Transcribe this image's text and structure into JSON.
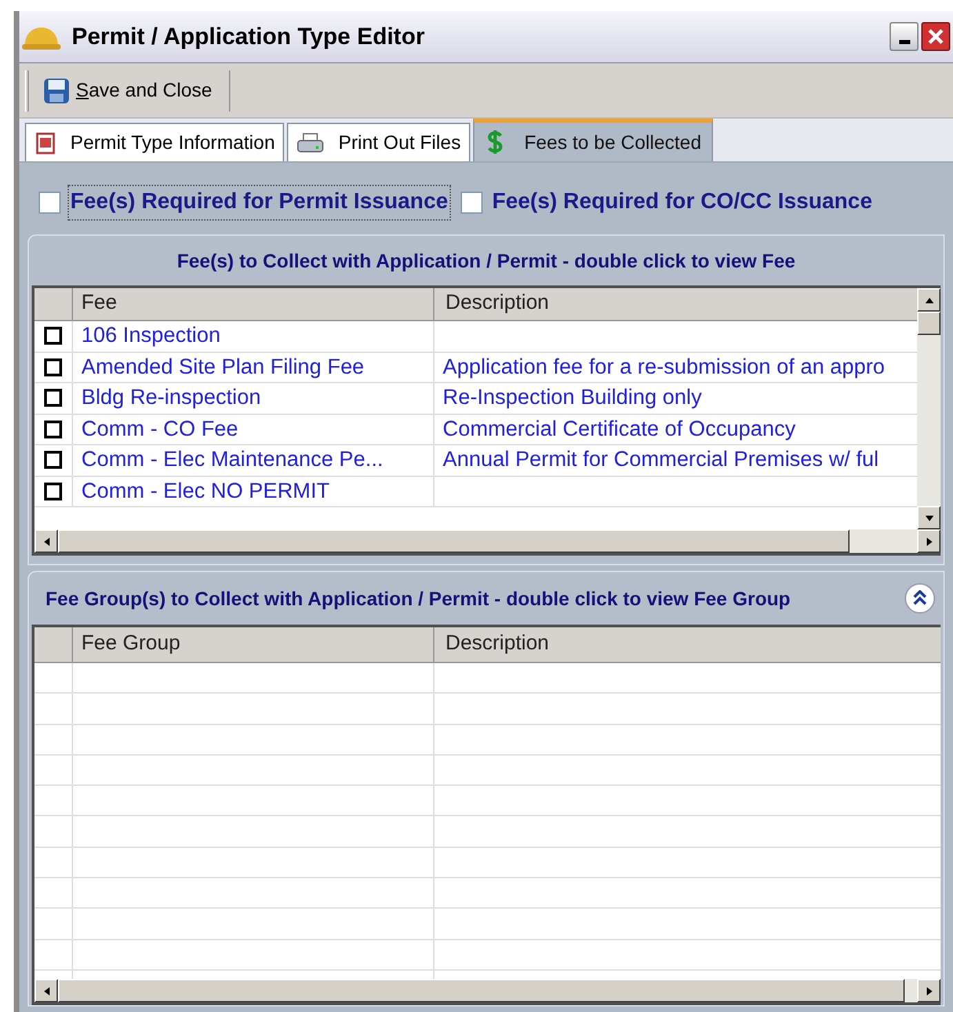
{
  "window": {
    "title": "Permit / Application Type Editor"
  },
  "toolbar": {
    "buttons": [
      {
        "label": "Save and Close"
      }
    ]
  },
  "tabs": [
    {
      "label": "Permit Type Information",
      "selected": false
    },
    {
      "label": "Print Out Files",
      "selected": false
    },
    {
      "label": "Fees to be Collected",
      "selected": true
    }
  ],
  "options": [
    {
      "label": "Fee(s) Required for Permit Issuance",
      "checked": false,
      "focused": true
    },
    {
      "label": "Fee(s) Required for CO/CC Issuance",
      "checked": false,
      "focused": false
    }
  ],
  "fees_panel": {
    "title": "Fee(s) to Collect with Application / Permit - double click to view Fee",
    "columns": [
      "Fee",
      "Description"
    ],
    "rows": [
      {
        "fee": "106 Inspection",
        "description": "",
        "checked": false
      },
      {
        "fee": "Amended Site Plan Filing Fee",
        "description": "Application fee for a re-submission of an appro",
        "checked": false
      },
      {
        "fee": "Bldg Re-inspection",
        "description": "Re-Inspection Building only",
        "checked": false
      },
      {
        "fee": "Comm - CO Fee",
        "description": "Commercial Certificate of Occupancy",
        "checked": false
      },
      {
        "fee": "Comm - Elec Maintenance Pe...",
        "description": "Annual Permit for Commercial Premises w/ ful",
        "checked": false
      },
      {
        "fee": "Comm - Elec NO PERMIT",
        "description": "",
        "checked": false
      }
    ]
  },
  "fee_groups_panel": {
    "title": "Fee Group(s) to Collect with Application / Permit - double click to view Fee Group",
    "columns": [
      "Fee Group",
      "Description"
    ]
  }
}
